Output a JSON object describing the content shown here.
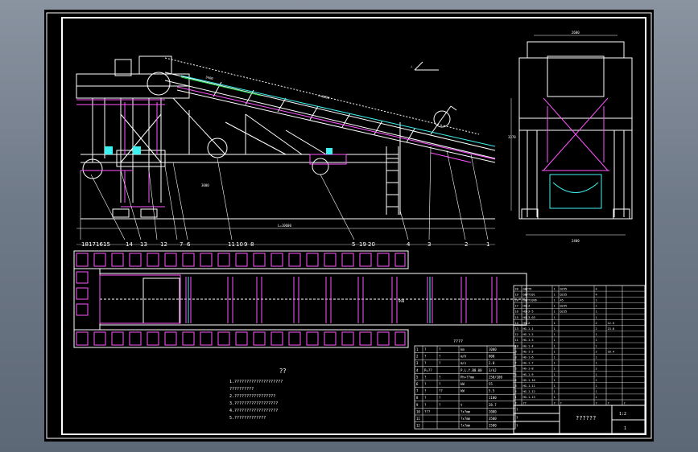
{
  "view_labels": {
    "elevation_title_mark": "∠",
    "top_dim": "h=9690",
    "left_dim": "3000",
    "span_dim": "L=10600",
    "incline_dim": "3400",
    "plan_dim": "990",
    "side_width_top": "2600",
    "side_width_bottom": "2400",
    "side_height": "3370"
  },
  "callouts": [
    "18",
    "17",
    "16",
    "15",
    "14",
    "13",
    "12",
    "7",
    "6",
    "11",
    "10",
    "9",
    "8",
    "5",
    "19",
    "20",
    "4",
    "3",
    "2",
    "1"
  ],
  "notes": {
    "heading": "??",
    "lines": [
      "1.????????????????????",
      "  ??????????",
      "2.?????????????????",
      "3.??????????????????",
      "4.??????????????????",
      "5.?????????????"
    ]
  },
  "spec_table": {
    "title": "????",
    "rows": [
      [
        "1",
        "?",
        "?",
        "km",
        "1000"
      ],
      [
        "2",
        "?",
        "?",
        "m/h",
        "800"
      ],
      [
        "3",
        "?",
        "?",
        "m/s",
        "2.0"
      ],
      [
        "4",
        "P=??",
        "",
        "P.L.Y.B0.00",
        "3/4J"
      ],
      [
        "5",
        "?",
        "?",
        "Ph=??mm",
        "250/100"
      ],
      [
        "6",
        "?",
        "?",
        "kW",
        "55"
      ],
      [
        "7",
        "?",
        "??",
        "kW",
        "5.5"
      ],
      [
        "8",
        "?",
        "?",
        "",
        "1100"
      ],
      [
        "9",
        "?",
        "?",
        "t",
        "28.7"
      ],
      [
        "10",
        "???",
        "",
        "?x?mm",
        "2000"
      ],
      [
        "11",
        "",
        "",
        "?x?mm",
        "3500"
      ],
      [
        "12",
        "",
        "",
        "?x?mm",
        "2500"
      ]
    ]
  },
  "parts_list": {
    "rows": [
      [
        "20",
        "GB/T9",
        "1",
        "Q235",
        "4",
        "",
        ""
      ],
      [
        "19",
        "GB/T101",
        "1",
        "Q235",
        "4",
        "",
        ""
      ],
      [
        "18",
        "GB/T1096",
        "1",
        "45",
        "1",
        "",
        ""
      ],
      [
        "17",
        "HG-3",
        "1",
        "Q235",
        "1",
        "",
        ""
      ],
      [
        "16",
        "HG-3-5",
        "1",
        "Q235",
        "1",
        "",
        ""
      ],
      [
        "15",
        "HG-3-03",
        "1",
        "",
        "1",
        "",
        ""
      ],
      [
        "14",
        "HG-2",
        "1",
        "",
        "2",
        "12.5",
        ""
      ],
      [
        "13",
        "HG-1-1",
        "1",
        "",
        "2",
        "23.8",
        ""
      ],
      [
        "12",
        "HG-1-2",
        "1",
        "",
        "1",
        "",
        ""
      ],
      [
        "11",
        "HG-1-3",
        "1",
        "",
        "1",
        "",
        ""
      ],
      [
        "10",
        "HG-1-4",
        "1",
        "",
        "1",
        "",
        ""
      ],
      [
        "9",
        "HG-1-5",
        "1",
        "",
        "2",
        "18.4",
        ""
      ],
      [
        "8",
        "HG-1-6",
        "1",
        "",
        "1",
        "",
        ""
      ],
      [
        "7",
        "HG-1-7",
        "1",
        "",
        "1",
        "",
        ""
      ],
      [
        "6",
        "HG-1-8",
        "1",
        "",
        "2",
        "",
        ""
      ],
      [
        "5",
        "HG-1-9",
        "1",
        "",
        "1",
        "",
        ""
      ],
      [
        "4",
        "HG-1-10",
        "1",
        "",
        "1",
        "",
        ""
      ],
      [
        "3",
        "HG-1-11",
        "1",
        "",
        "1",
        "",
        ""
      ],
      [
        "2",
        "HG-1-12",
        "1",
        "",
        "1",
        "",
        ""
      ],
      [
        "1",
        "HG-1-13",
        "1",
        "",
        "1",
        "",
        ""
      ]
    ],
    "header": [
      "?",
      "??",
      "?",
      "?",
      "?",
      "?",
      "?"
    ]
  },
  "title_block": {
    "name": "??????",
    "scale": "1:2",
    "sheet": "1",
    "labels": [
      "?",
      "?",
      "?",
      "?",
      "?",
      "?"
    ]
  },
  "colors": {
    "paper": "#000000",
    "frame": "#ffffff",
    "structure_white": "#ffffff",
    "structure_magenta": "#ff55ff",
    "belt_cyan": "#3ff0f0",
    "belt_green": "#22dd44",
    "page_bg": "#6f7a88"
  }
}
